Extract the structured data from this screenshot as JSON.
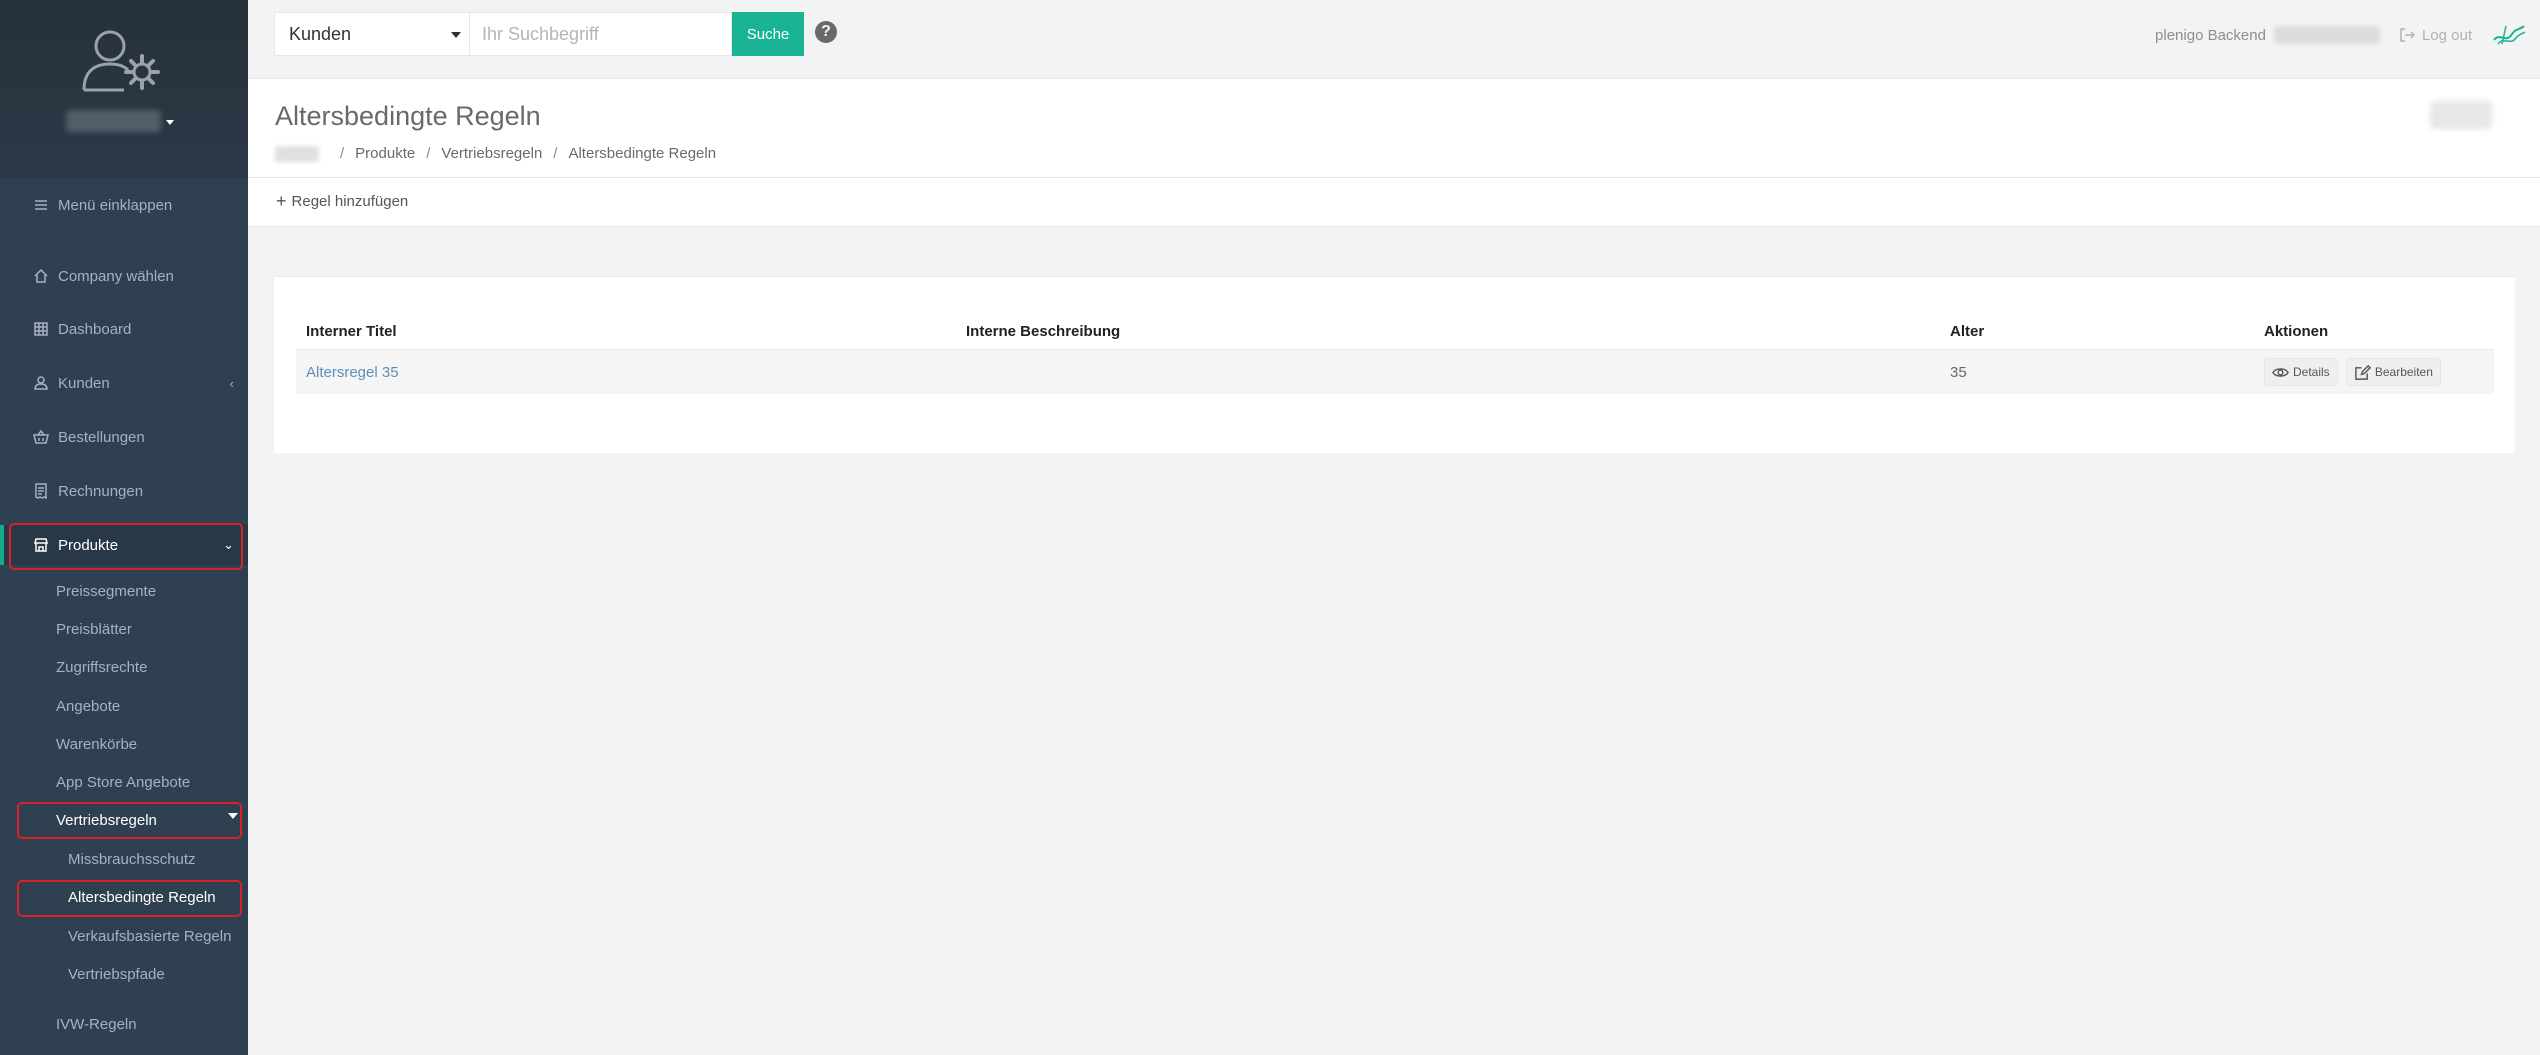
{
  "sidebar": {
    "collapse_label": "Menü einklappen",
    "items": [
      {
        "label": "Company wählen"
      },
      {
        "label": "Dashboard"
      },
      {
        "label": "Kunden"
      },
      {
        "label": "Bestellungen"
      },
      {
        "label": "Rechnungen"
      },
      {
        "label": "Produkte"
      }
    ],
    "produkte_sub": [
      "Preissegmente",
      "Preisblätter",
      "Zugriffsrechte",
      "Angebote",
      "Warenkörbe",
      "App Store Angebote",
      "Vertriebsregeln"
    ],
    "vertriebsregeln_sub": [
      "Missbrauchsschutz",
      "Altersbedingte Regeln",
      "Verkaufsbasierte Regeln",
      "Vertriebspfade"
    ],
    "ivw_label": "IVW-Regeln"
  },
  "search": {
    "category": "Kunden",
    "placeholder": "Ihr Suchbegriff",
    "button": "Suche"
  },
  "topbar": {
    "help": "?",
    "backend_label": "plenigo Backend",
    "logout": "Log out"
  },
  "heading": {
    "title": "Altersbedingte Regeln",
    "breadcrumb": [
      "Produkte",
      "Vertriebsregeln",
      "Altersbedingte Regeln"
    ]
  },
  "toolbar": {
    "add_rule": "Regel hinzufügen"
  },
  "table": {
    "headers": [
      "Interner Titel",
      "Interne Beschreibung",
      "Alter",
      "Aktionen"
    ],
    "rows": [
      {
        "title": "Altersregel 35",
        "description": "",
        "age": "35"
      }
    ],
    "actions": {
      "details": "Details",
      "edit": "Bearbeiten"
    }
  },
  "colors": {
    "sidebar_bg": "#2f4050",
    "accent": "#1ab394",
    "highlight": "#d9202b",
    "link": "#5b8fb9"
  }
}
